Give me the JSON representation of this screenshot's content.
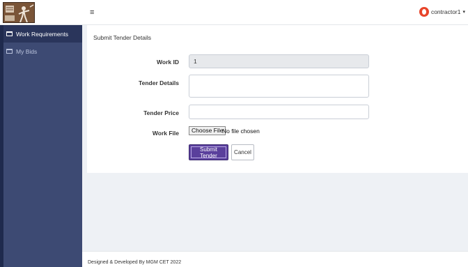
{
  "header": {
    "menu_icon": "menu-icon",
    "user_name": "contractor1",
    "caret": "▾"
  },
  "sidebar": {
    "items": [
      {
        "label": "Work Requirements",
        "icon": "table-icon",
        "active": true
      },
      {
        "label": "My Bids",
        "icon": "table-icon",
        "active": false
      }
    ]
  },
  "form": {
    "title": "Submit Tender Details",
    "work_id_label": "Work ID",
    "work_id_value": "1",
    "tender_details_label": "Tender Details",
    "tender_details_value": "",
    "tender_price_label": "Tender Price",
    "tender_price_value": "",
    "work_file_label": "Work File",
    "choose_file_label": "Choose File",
    "file_status": "No file chosen",
    "submit_label": "Submit Tender",
    "cancel_label": "Cancel"
  },
  "footer": {
    "text": "Designed & Developed By MGM CET 2022"
  },
  "colors": {
    "sidebar_bg": "#3d4a73",
    "sidebar_active": "#2a355b",
    "submit_button": "#5a3f9c",
    "avatar": "#e8442a"
  }
}
